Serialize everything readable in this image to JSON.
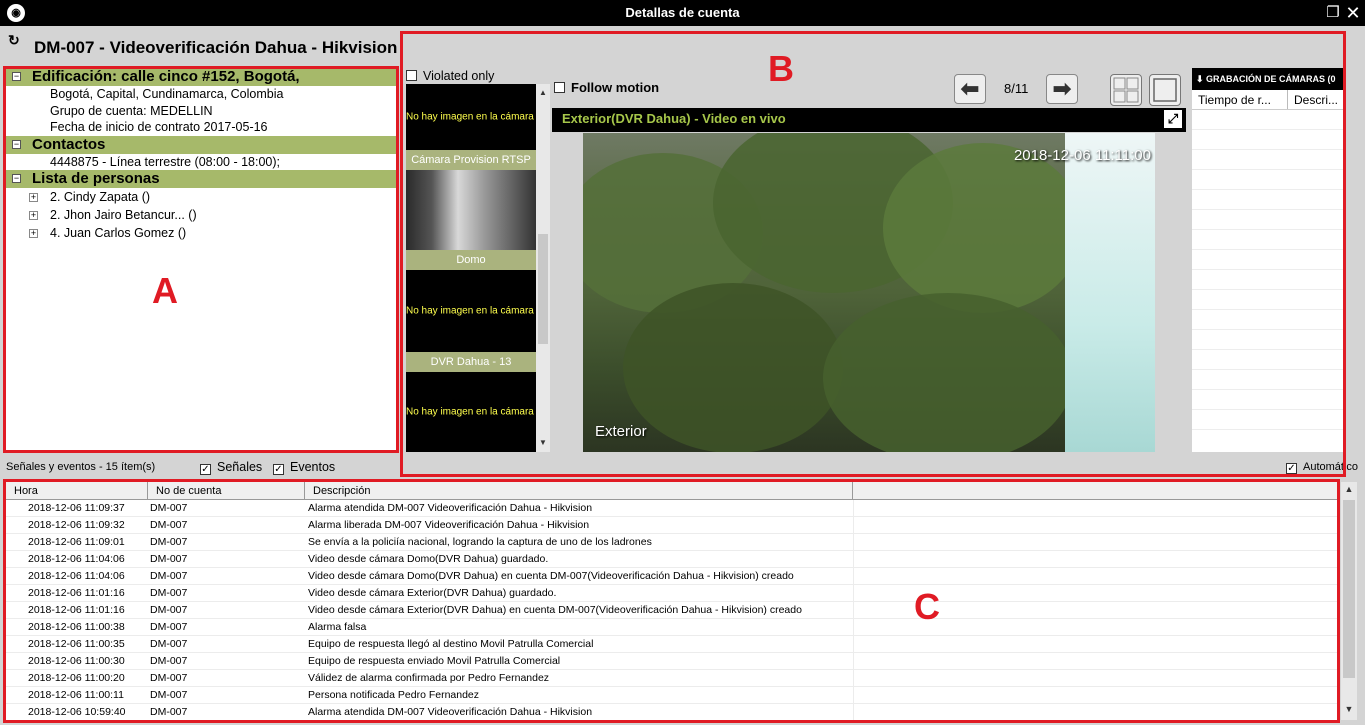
{
  "window": {
    "title": "Detallas de cuenta",
    "restore_icon": "restore-icon",
    "close_icon": "close-icon"
  },
  "account": {
    "title": "DM-007 - Videoverificación Dahua - Hikvision"
  },
  "tree": {
    "building": {
      "header": "Edificación: calle cinco #152,  Bogotá,",
      "lines": [
        "Bogotá, Capital, Cundinamarca, Colombia",
        "Grupo de cuenta: MEDELLIN",
        "Fecha de inicio de contrato 2017-05-16"
      ]
    },
    "contacts": {
      "header": "Contactos",
      "lines": [
        "4448875 - Línea terrestre (08:00 - 18:00);"
      ]
    },
    "persons": {
      "header": "Lista de personas",
      "items": [
        "2. Cindy Zapata ()",
        "2. Jhon Jairo Betancur... ()",
        "4. Juan Carlos Gomez ()"
      ]
    }
  },
  "cameras": {
    "violated_only": "Violated only",
    "follow_motion": "Follow motion",
    "no_image_text": "No hay imagen en la cámara",
    "thumbs": [
      "Cámara Provision RTSP",
      "Domo",
      "DVR Dahua - 13"
    ],
    "page_indicator": "8/11",
    "video_title": "Exterior(DVR Dahua) - Video en vivo",
    "timestamp": "2018-12-06 11:11:00",
    "camera_name": "Exterior"
  },
  "recording": {
    "header": "GRABACIÓN DE CÁMARAS (0",
    "columns": [
      "Tiempo de r...",
      "Descri..."
    ]
  },
  "events_bar": {
    "count": "Señales y eventos -  15 ítem(s)",
    "signals": "Señales",
    "events": "Eventos",
    "automatic": "Automático"
  },
  "events_table": {
    "columns": [
      "Hora",
      "No de cuenta",
      "Descripción"
    ],
    "rows": [
      [
        "2018-12-06 11:09:37",
        "DM-007",
        "Alarma atendida DM-007 Videoverificación Dahua - Hikvision"
      ],
      [
        "2018-12-06 11:09:32",
        "DM-007",
        "Alarma liberada DM-007 Videoverificación Dahua - Hikvision"
      ],
      [
        "2018-12-06 11:09:01",
        "DM-007",
        "Se envía a la policiía nacional, logrando la captura de uno de los ladrones"
      ],
      [
        "2018-12-06 11:04:06",
        "DM-007",
        "Video desde cámara Domo(DVR Dahua) guardado."
      ],
      [
        "2018-12-06 11:04:06",
        "DM-007",
        "Video desde cámara Domo(DVR Dahua) en cuenta DM-007(Videoverificación Dahua - Hikvision) creado"
      ],
      [
        "2018-12-06 11:01:16",
        "DM-007",
        "Video desde cámara Exterior(DVR Dahua) guardado."
      ],
      [
        "2018-12-06 11:01:16",
        "DM-007",
        "Video desde cámara Exterior(DVR Dahua) en cuenta DM-007(Videoverificación Dahua - Hikvision) creado"
      ],
      [
        "2018-12-06 11:00:38",
        "DM-007",
        "Alarma falsa"
      ],
      [
        "2018-12-06 11:00:35",
        "DM-007",
        "Equipo de respuesta llegó al destino Movil Patrulla Comercial"
      ],
      [
        "2018-12-06 11:00:30",
        "DM-007",
        "Equipo de respuesta enviado Movil Patrulla Comercial"
      ],
      [
        "2018-12-06 11:00:20",
        "DM-007",
        "Válidez de alarma confirmada por Pedro Fernandez"
      ],
      [
        "2018-12-06 11:00:11",
        "DM-007",
        "Persona notificada Pedro Fernandez"
      ],
      [
        "2018-12-06 10:59:40",
        "DM-007",
        "Alarma atendida DM-007 Videoverificación Dahua - Hikvision"
      ]
    ]
  },
  "annotations": {
    "a": "A",
    "b": "B",
    "c": "C"
  },
  "colors": {
    "group_header": "#a6b96a",
    "thumb_label": "#aab37e",
    "video_title": "#a6c64a",
    "annotation": "#e01b24"
  }
}
